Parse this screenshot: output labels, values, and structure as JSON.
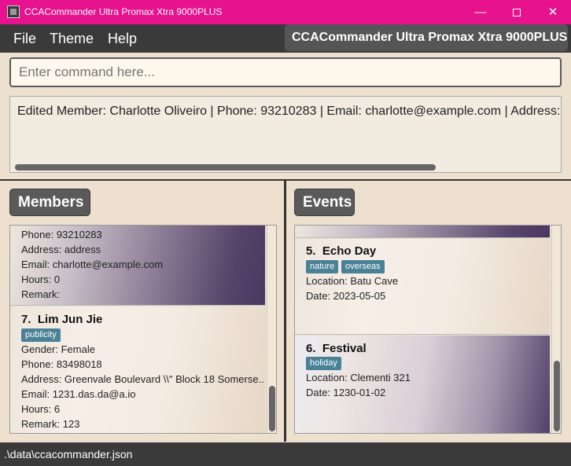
{
  "window": {
    "title": "CCACommander Ultra Promax Xtra 9000PLUS",
    "minimize": "—",
    "close": "✕"
  },
  "menu": {
    "items": [
      "File",
      "Theme",
      "Help"
    ],
    "app_name": "CCACommander Ultra Promax Xtra 9000PLUS"
  },
  "command": {
    "placeholder": "Enter command here...",
    "value": ""
  },
  "result": {
    "message": "Edited Member: Charlotte Oliveiro | Phone: 93210283 | Email: charlotte@example.com | Address: address"
  },
  "members": {
    "title": "Members",
    "cards": [
      {
        "phone": "Phone: 93210283",
        "address": "Address: address",
        "email": "Email: charlotte@example.com",
        "hours": "Hours: 0",
        "remark": "Remark:"
      },
      {
        "index": "7.",
        "name": "Lim Jun Jie",
        "tags": [
          "publicity"
        ],
        "gender": "Gender: Female",
        "phone": "Phone: 83498018",
        "address": "Address: Greenvale Boulevard \\\\\" Block 18 Somerse...",
        "email": "Email: 1231.das.da@a.io",
        "hours": "Hours: 6",
        "remark": "Remark: 123"
      }
    ]
  },
  "events": {
    "title": "Events",
    "cards": [
      {
        "index": "5.",
        "name": "Echo Day",
        "tags": [
          "nature",
          "overseas"
        ],
        "location": "Location: Batu Cave",
        "date": "Date: 2023-05-05"
      },
      {
        "index": "6.",
        "name": "Festival",
        "tags": [
          "holiday"
        ],
        "location": "Location: Clementi 321",
        "date": "Date: 1230-01-02"
      }
    ]
  },
  "status": {
    "path": ".\\data\\ccacommander.json"
  }
}
